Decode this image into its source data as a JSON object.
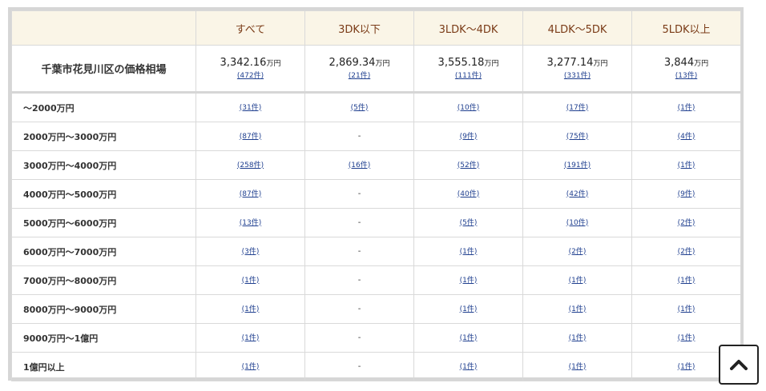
{
  "table": {
    "columns": [
      "すべて",
      "3DK以下",
      "3LDK〜4DK",
      "4LDK〜5DK",
      "5LDK以上"
    ],
    "avg_title": "千葉市花見川区の価格相場",
    "avg_unit": "万円",
    "averages": [
      {
        "value": "3,342.16",
        "count": "(472件)"
      },
      {
        "value": "2,869.34",
        "count": "(21件)"
      },
      {
        "value": "3,555.18",
        "count": "(111件)"
      },
      {
        "value": "3,277.14",
        "count": "(331件)"
      },
      {
        "value": "3,844",
        "count": "(13件)"
      }
    ],
    "rows": [
      {
        "label": "〜2000万円",
        "cells": [
          "(31件)",
          "(5件)",
          "(10件)",
          "(17件)",
          "(1件)"
        ]
      },
      {
        "label": "2000万円〜3000万円",
        "cells": [
          "(87件)",
          "-",
          "(9件)",
          "(75件)",
          "(4件)"
        ]
      },
      {
        "label": "3000万円〜4000万円",
        "cells": [
          "(258件)",
          "(16件)",
          "(52件)",
          "(191件)",
          "(1件)"
        ]
      },
      {
        "label": "4000万円〜5000万円",
        "cells": [
          "(87件)",
          "-",
          "(40件)",
          "(42件)",
          "(9件)"
        ]
      },
      {
        "label": "5000万円〜6000万円",
        "cells": [
          "(13件)",
          "-",
          "(5件)",
          "(10件)",
          "(2件)"
        ]
      },
      {
        "label": "6000万円〜7000万円",
        "cells": [
          "(3件)",
          "-",
          "(1件)",
          "(2件)",
          "(2件)"
        ]
      },
      {
        "label": "7000万円〜8000万円",
        "cells": [
          "(1件)",
          "-",
          "(1件)",
          "(1件)",
          "(1件)"
        ]
      },
      {
        "label": "8000万円〜9000万円",
        "cells": [
          "(1件)",
          "-",
          "(1件)",
          "(1件)",
          "(1件)"
        ]
      },
      {
        "label": "9000万円〜1億円",
        "cells": [
          "(1件)",
          "-",
          "(1件)",
          "(1件)",
          "(1件)"
        ]
      },
      {
        "label": "1億円以上",
        "cells": [
          "(1件)",
          "-",
          "(1件)",
          "(1件)",
          "(1件)"
        ]
      }
    ]
  },
  "back_to_top": {
    "icon": "chevron-up-icon"
  },
  "colors": {
    "header_bg": "#faf5e7",
    "header_text": "#7a3b17",
    "link": "#1f3f8f",
    "border": "#d6d6d6"
  }
}
